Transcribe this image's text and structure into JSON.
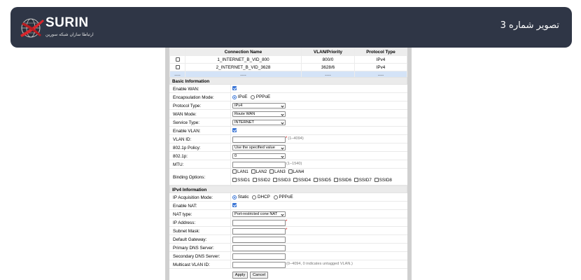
{
  "banner": {
    "title": "تصویر شماره 3",
    "logo_word": "SURIN",
    "logo_sub": "ارتباطا سازان شبکه سورین",
    "bg_color": "#2f3646"
  },
  "connections": {
    "headers": [
      "",
      "Connection Name",
      "VLAN/Priority",
      "Protocol Type"
    ],
    "rows": [
      {
        "name": "1_INTERNET_B_VID_800",
        "vlan": "800/0",
        "protocol": "IPv4"
      },
      {
        "name": "2_INTERNET_B_VID_3628",
        "vlan": "3628/6",
        "protocol": "IPv4"
      }
    ],
    "placeholder_row": {
      "a": "----",
      "b": "----",
      "c": "----",
      "d": "----"
    }
  },
  "basic": {
    "section_title": "Basic Information",
    "enable_wan_label": "Enable WAN:",
    "encap_label": "Encapsulation Mode:",
    "encap_opt1": "IPoE",
    "encap_opt2": "PPPoE",
    "protocol_label": "Protocol Type:",
    "protocol_value": "IPv4",
    "wan_mode_label": "WAN Mode:",
    "wan_mode_value": "Route WAN",
    "service_label": "Service Type:",
    "service_value": "INTERNET",
    "enable_vlan_label": "Enable VLAN:",
    "vlan_id_label": "VLAN ID:",
    "vlan_id_hint": "(1–4094)",
    "policy_label": "802.1p Policy:",
    "policy_value": "Use the specified value",
    "p8021_label": "802.1p:",
    "p8021_value": "0",
    "mtu_label": "MTU:",
    "mtu_hint": "(1–1540)",
    "binding_label": "Binding Options:",
    "binding_lan": [
      "LAN1",
      "LAN2",
      "LAN3",
      "LAN4"
    ],
    "binding_ssid": [
      "SSID1",
      "SSID2",
      "SSID3",
      "SSID4",
      "SSID5",
      "SSID6",
      "SSID7",
      "SSID8"
    ]
  },
  "ipv4": {
    "section_title": "IPv4 Information",
    "acq_label": "IP Acquisition Mode:",
    "acq_opt1": "Static",
    "acq_opt2": "DHCP",
    "acq_opt3": "PPPoE",
    "nat_label": "Enable NAT:",
    "nat_type_label": "NAT type:",
    "nat_type_value": "Port-restricted cone NAT",
    "ip_label": "IP Address:",
    "mask_label": "Subnet Mask:",
    "gw_label": "Default Gateway:",
    "dns1_label": "Primary DNS Server:",
    "dns2_label": "Secondary DNS Server:",
    "mvlan_label": "Multicast VLAN ID:",
    "mvlan_hint": "(0–4094, 0 indicates untagged VLAN.)",
    "required_mark": "*"
  },
  "buttons": {
    "apply": "Apply",
    "cancel": "Cancel"
  }
}
